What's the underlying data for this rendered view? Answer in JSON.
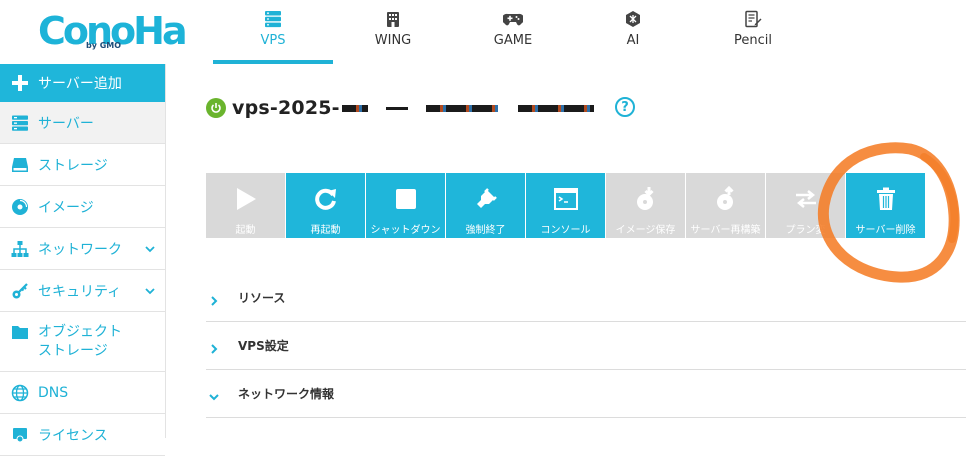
{
  "brand": {
    "logo_text": "ConoHa",
    "logo_sub": "by GMO",
    "accent": "#1fb6da",
    "disabled": "#d9d9d9",
    "power_on": "#6ab42d",
    "highlight": "#f47920"
  },
  "nav": {
    "tabs": [
      {
        "label": "VPS",
        "icon": "server-stack-icon",
        "active": true
      },
      {
        "label": "WING",
        "icon": "building-icon",
        "active": false
      },
      {
        "label": "GAME",
        "icon": "gamepad-icon",
        "active": false
      },
      {
        "label": "AI",
        "icon": "ai-chip-icon",
        "active": false
      },
      {
        "label": "Pencil",
        "icon": "pencil-note-icon",
        "active": false
      }
    ]
  },
  "sidebar": {
    "items": [
      {
        "label": "サーバー追加",
        "icon": "plus-icon"
      },
      {
        "label": "サーバー",
        "icon": "server-icon"
      },
      {
        "label": "ストレージ",
        "icon": "storage-icon"
      },
      {
        "label": "イメージ",
        "icon": "disc-icon"
      },
      {
        "label": "ネットワーク",
        "icon": "network-icon"
      },
      {
        "label": "セキュリティ",
        "icon": "key-icon"
      },
      {
        "label": "オブジェクト",
        "label2": "ストレージ",
        "icon": "folder-icon"
      },
      {
        "label": "DNS",
        "icon": "globe-icon"
      },
      {
        "label": "ライセンス",
        "icon": "license-icon"
      }
    ]
  },
  "server": {
    "name": "vps-2025-",
    "status": "running"
  },
  "actions": [
    {
      "label": "起動",
      "icon": "play-icon",
      "enabled": false
    },
    {
      "label": "再起動",
      "icon": "restart-icon",
      "enabled": true
    },
    {
      "label": "シャットダウン",
      "icon": "stop-icon",
      "enabled": true
    },
    {
      "label": "強制終了",
      "icon": "plug-icon",
      "enabled": true
    },
    {
      "label": "コンソール",
      "icon": "console-icon",
      "enabled": true
    },
    {
      "label": "イメージ保存",
      "icon": "image-save-icon",
      "enabled": false
    },
    {
      "label": "サーバー再構築",
      "icon": "rebuild-icon",
      "enabled": false
    },
    {
      "label": "プラン変",
      "icon": "plan-change-icon",
      "enabled": false
    },
    {
      "label": "サーバー削除",
      "icon": "trash-icon",
      "enabled": true
    }
  ],
  "sections": [
    {
      "label": "リソース",
      "expanded": false
    },
    {
      "label": "VPS設定",
      "expanded": false
    },
    {
      "label": "ネットワーク情報",
      "expanded": true
    }
  ]
}
